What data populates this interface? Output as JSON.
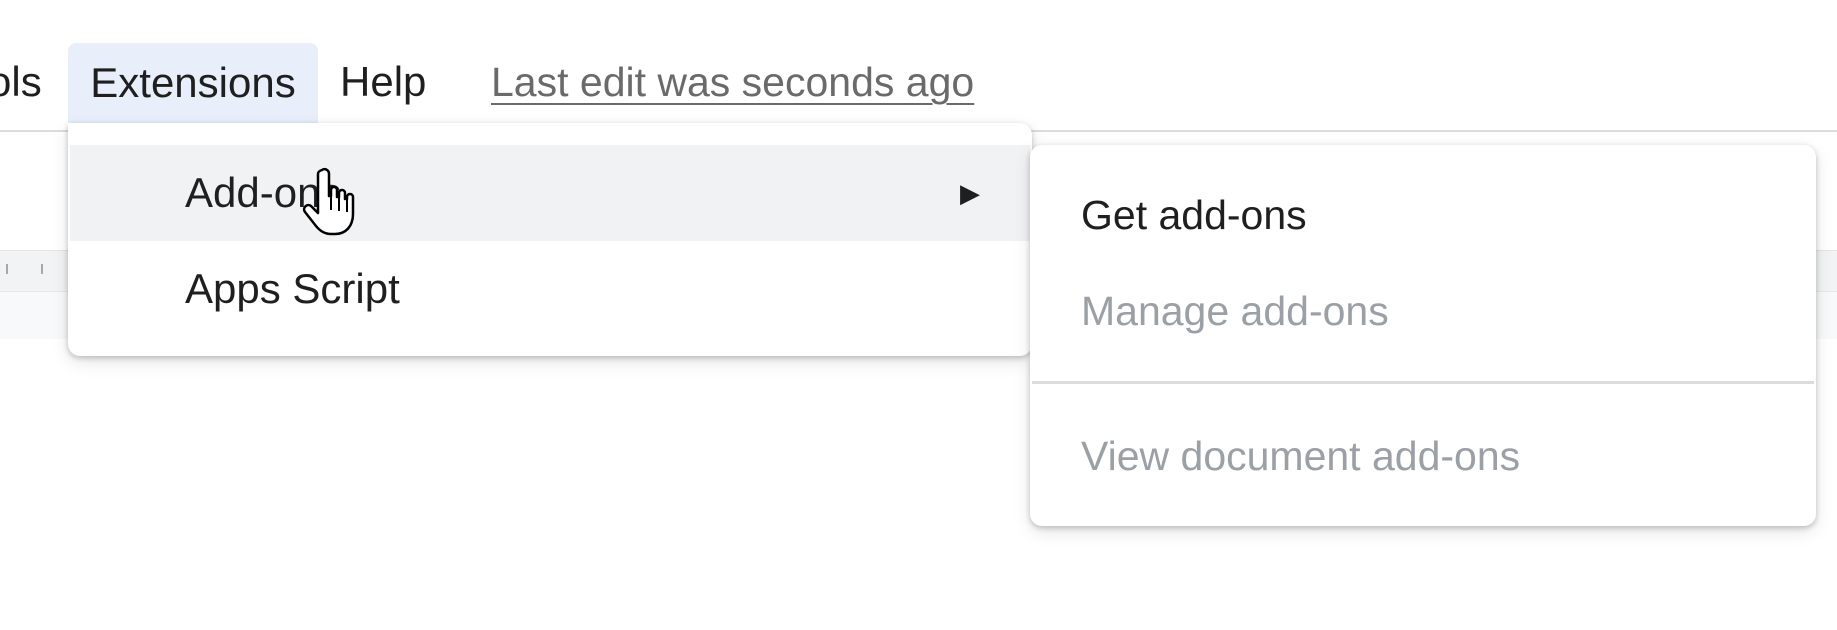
{
  "menubar": {
    "tools_partial": "ols",
    "extensions": "Extensions",
    "help": "Help",
    "last_edit": "Last edit was seconds ago"
  },
  "extensions_menu": {
    "items": [
      {
        "label": "Add-ons",
        "has_submenu": true,
        "hovered": true
      },
      {
        "label": "Apps Script",
        "has_submenu": false,
        "hovered": false
      }
    ],
    "submenu_arrow": "▶"
  },
  "addons_submenu": {
    "items": [
      {
        "label": "Get add-ons",
        "enabled": true
      },
      {
        "label": "Manage add-ons",
        "enabled": false
      },
      {
        "label": "View document add-ons",
        "enabled": false
      }
    ]
  },
  "cursor": {
    "icon": "hand-pointer-icon"
  },
  "colors": {
    "active_menu_bg": "#e9eefb",
    "hover_item_bg": "#f1f2f4",
    "text": "#1f1f1f",
    "disabled_text": "#9aa0a6",
    "last_edit_text": "#6a6a6a"
  }
}
